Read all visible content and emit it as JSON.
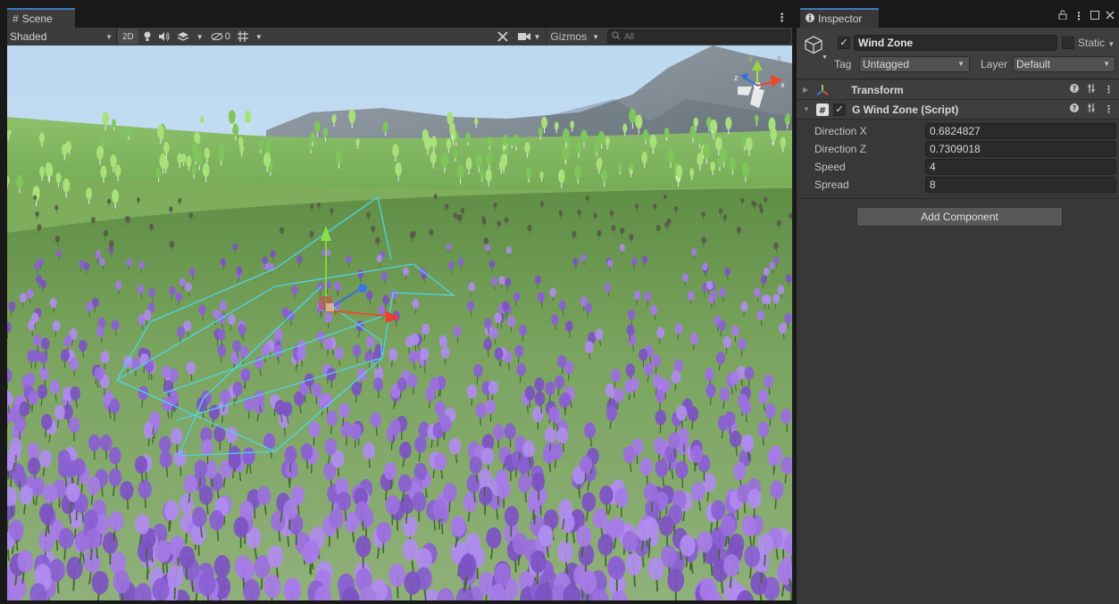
{
  "scene": {
    "tab_label": "Scene",
    "shading_mode": "Shaded",
    "mode_2d": "2D",
    "hidden_count": "0",
    "gizmos_label": "Gizmos",
    "search_placeholder": "All"
  },
  "inspector": {
    "tab_label": "Inspector",
    "object_name": "Wind Zone",
    "static_label": "Static",
    "tag_label": "Tag",
    "tag_value": "Untagged",
    "layer_label": "Layer",
    "layer_value": "Default",
    "components": [
      {
        "title": "Transform"
      },
      {
        "title": "G Wind Zone (Script)"
      }
    ],
    "properties": [
      {
        "label": "Direction X",
        "value": "0.6824827"
      },
      {
        "label": "Direction Z",
        "value": "0.7309018"
      },
      {
        "label": "Speed",
        "value": "4"
      },
      {
        "label": "Spread",
        "value": "8"
      }
    ],
    "add_component_label": "Add Component"
  },
  "gizmo_axes": {
    "x": "x",
    "y": "y",
    "z": "z"
  },
  "colors": {
    "accent": "#3a79bb",
    "panel_bg": "#383838",
    "field_bg": "#2a2a2a",
    "flower": "#9b6fe0",
    "grass": "#6e9a4c",
    "sky": "#cfe4f5",
    "wind_gizmo": "#4fd4e6"
  }
}
